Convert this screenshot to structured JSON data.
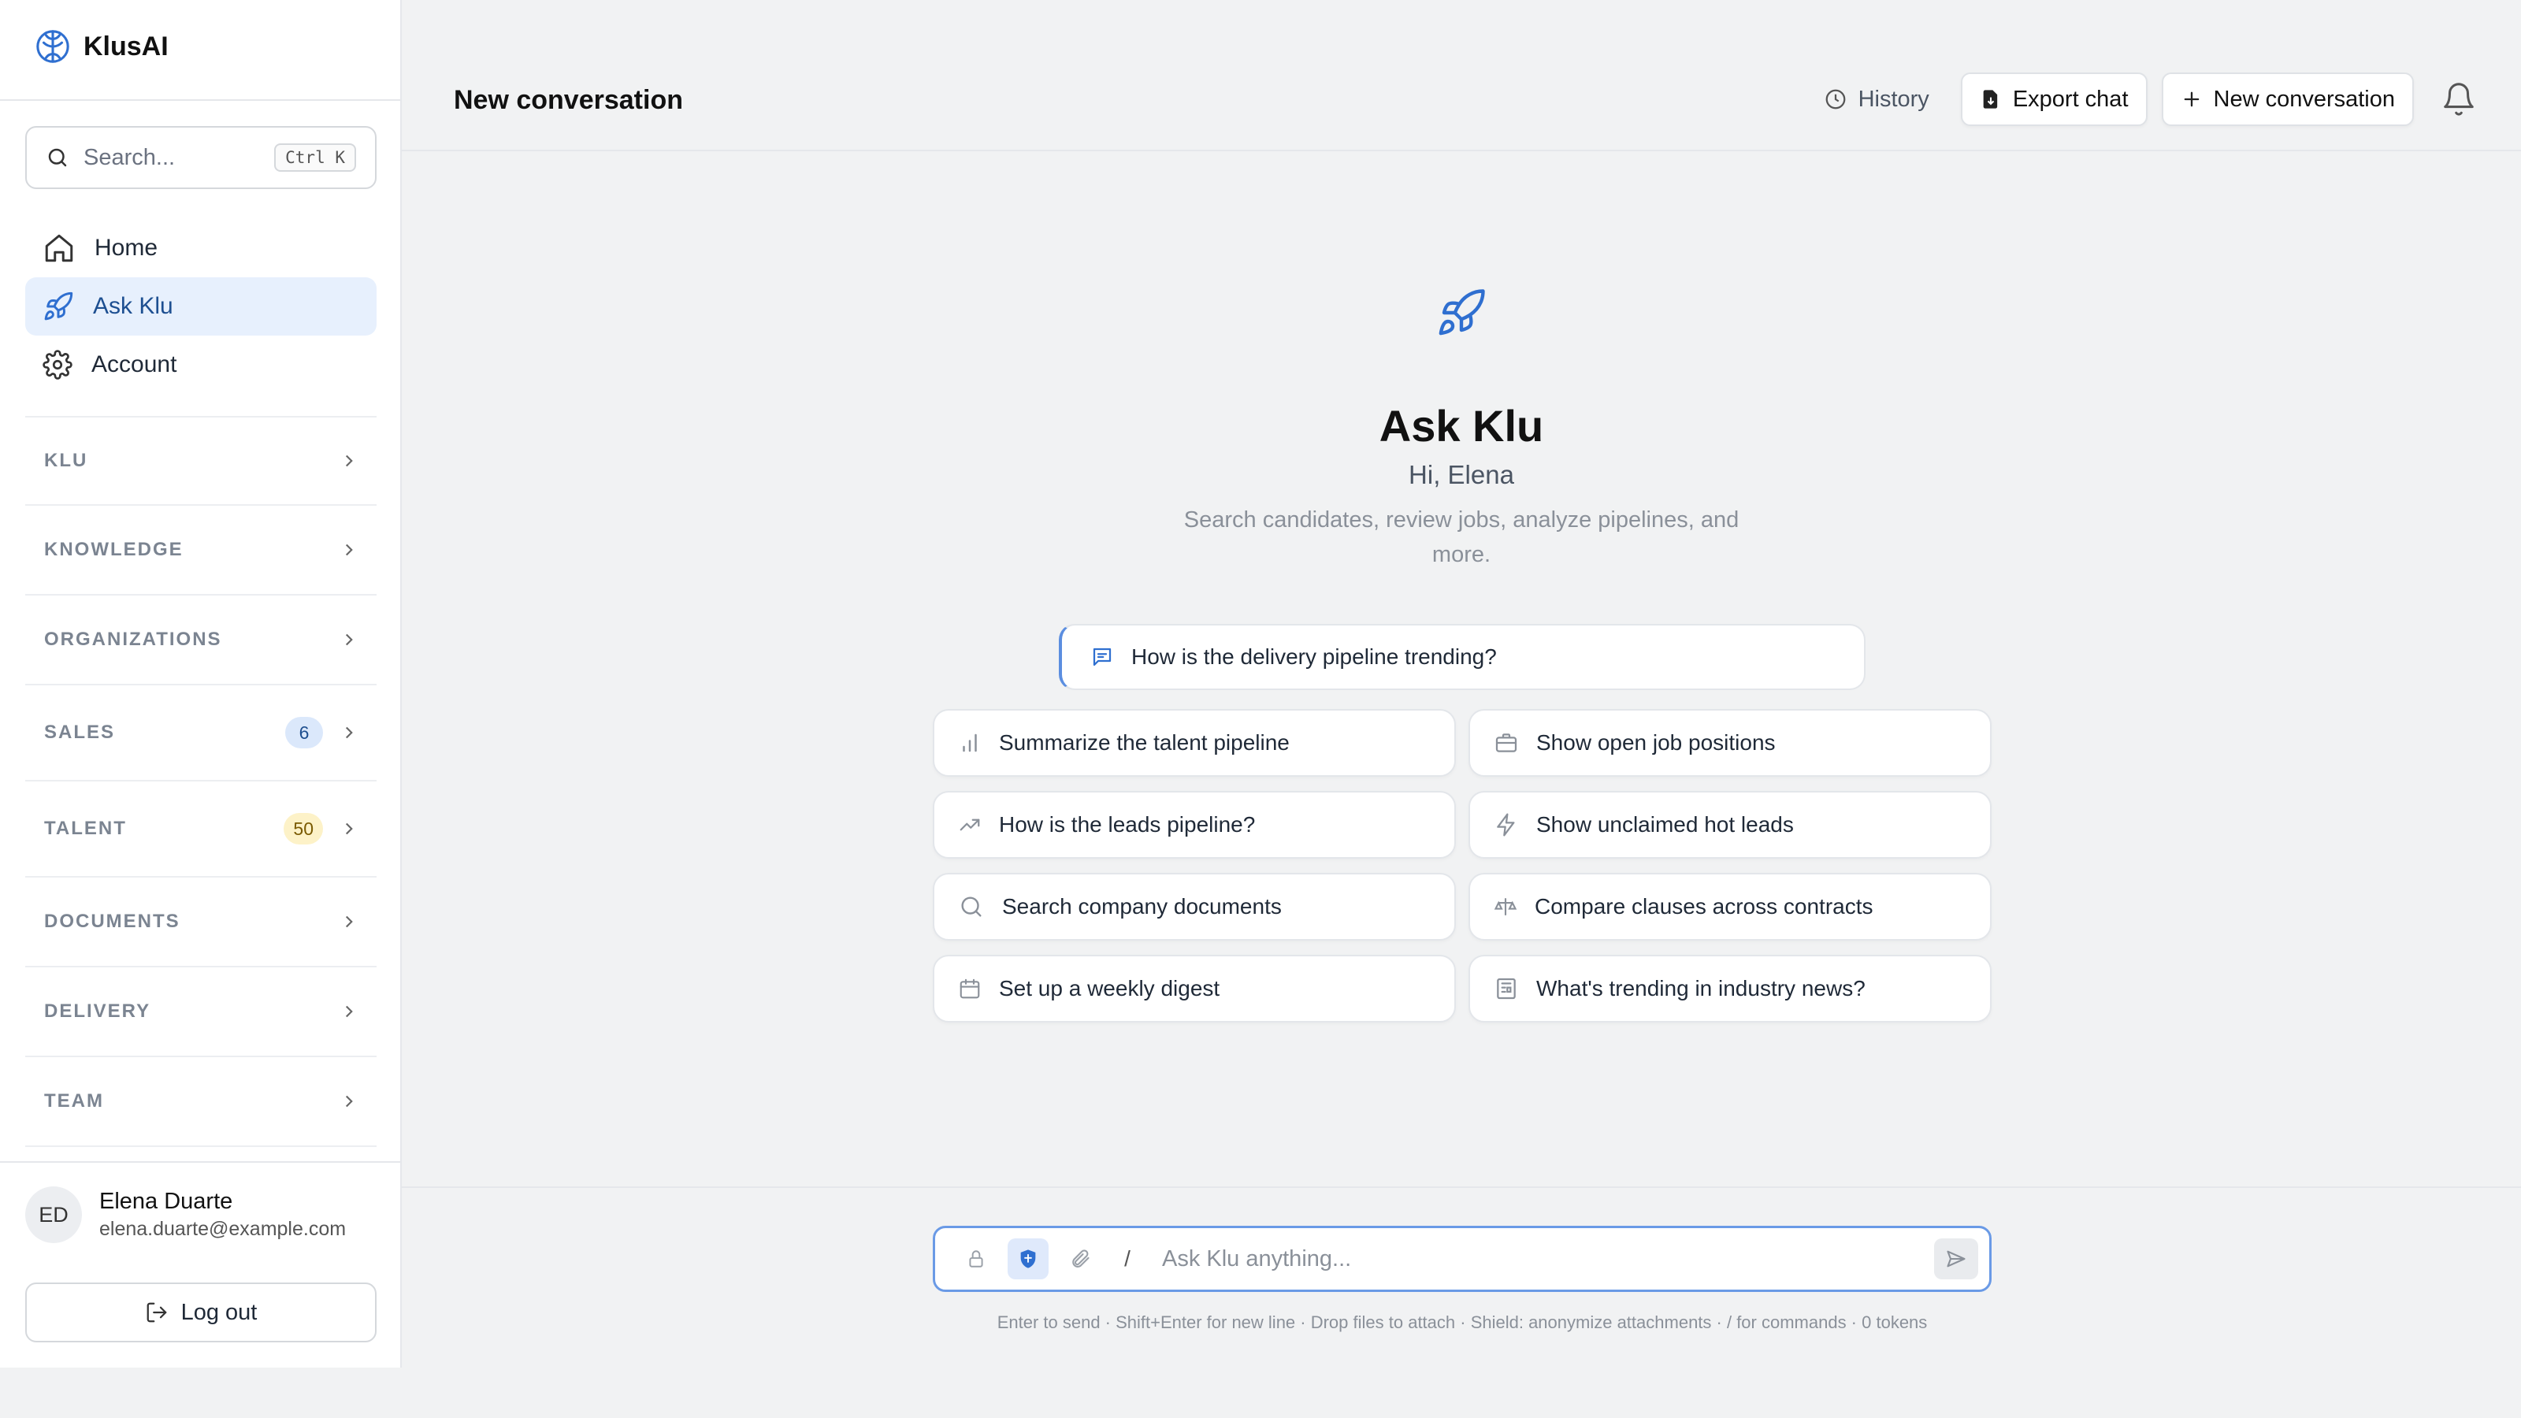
{
  "brand": {
    "name": "KlusAI"
  },
  "search": {
    "placeholder": "Search...",
    "shortcut": "Ctrl K"
  },
  "nav": [
    {
      "label": "Home",
      "icon": "home-icon",
      "active": false
    },
    {
      "label": "Ask Klu",
      "icon": "rocket-icon",
      "active": true
    },
    {
      "label": "Account",
      "icon": "gear-icon",
      "active": false
    }
  ],
  "sections": [
    {
      "label": "KLU",
      "badge": null
    },
    {
      "label": "KNOWLEDGE",
      "badge": null
    },
    {
      "label": "ORGANIZATIONS",
      "badge": null
    },
    {
      "label": "SALES",
      "badge": "6",
      "badge_color": "#dbe8fb"
    },
    {
      "label": "TALENT",
      "badge": "50",
      "badge_color": "#fdf2c8"
    },
    {
      "label": "DOCUMENTS",
      "badge": null
    },
    {
      "label": "DELIVERY",
      "badge": null
    },
    {
      "label": "TEAM",
      "badge": null
    }
  ],
  "user": {
    "initials": "ED",
    "name": "Elena Duarte",
    "email": "elena.duarte@example.com",
    "logout_label": "Log out"
  },
  "header": {
    "title": "New conversation",
    "history_label": "History",
    "export_label": "Export chat",
    "new_label": "New conversation"
  },
  "hero": {
    "title": "Ask Klu",
    "greeting": "Hi, Elena",
    "description": "Search candidates, review jobs, analyze pipelines, and more."
  },
  "featured_prompt": {
    "label": "How is the delivery pipeline trending?",
    "icon": "chat-icon"
  },
  "suggestions": [
    {
      "label": "Summarize the talent pipeline",
      "icon": "bar-chart-icon"
    },
    {
      "label": "Show open job positions",
      "icon": "briefcase-icon"
    },
    {
      "label": "How is the leads pipeline?",
      "icon": "trending-up-icon"
    },
    {
      "label": "Show unclaimed hot leads",
      "icon": "lightning-icon"
    },
    {
      "label": "Search company documents",
      "icon": "search-icon"
    },
    {
      "label": "Compare clauses across contracts",
      "icon": "scale-icon"
    },
    {
      "label": "Set up a weekly digest",
      "icon": "calendar-icon"
    },
    {
      "label": "What's trending in industry news?",
      "icon": "newspaper-icon"
    }
  ],
  "composer": {
    "placeholder": "Ask Klu anything...",
    "slash": "/",
    "hint": "Enter to send · Shift+Enter for new line · Drop files to attach · Shield: anonymize attachments · / for commands · 0 tokens"
  },
  "colors": {
    "accent": "#2f6fd0",
    "active_nav_bg": "#e7f0fd",
    "composer_border": "#6a9ae6"
  }
}
